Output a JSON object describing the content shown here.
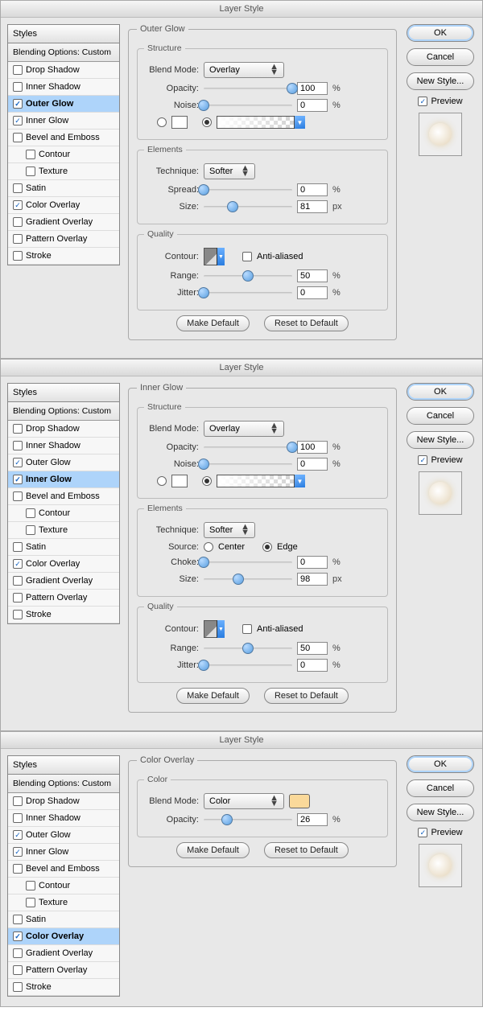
{
  "common": {
    "title": "Layer Style",
    "styles_head": "Styles",
    "blending": "Blending Options: Custom",
    "ok": "OK",
    "cancel": "Cancel",
    "new_style": "New Style...",
    "preview": "Preview",
    "make_default": "Make Default",
    "reset_default": "Reset to Default",
    "anti_aliased": "Anti-aliased",
    "units": {
      "pct": "%",
      "px": "px"
    }
  },
  "style_effects": [
    {
      "label": "Drop Shadow"
    },
    {
      "label": "Inner Shadow"
    },
    {
      "label": "Outer Glow"
    },
    {
      "label": "Inner Glow"
    },
    {
      "label": "Bevel and Emboss"
    },
    {
      "label": "Contour",
      "indent": true
    },
    {
      "label": "Texture",
      "indent": true
    },
    {
      "label": "Satin"
    },
    {
      "label": "Color Overlay"
    },
    {
      "label": "Gradient Overlay"
    },
    {
      "label": "Pattern Overlay"
    },
    {
      "label": "Stroke"
    }
  ],
  "panels": [
    {
      "selected": "Outer Glow",
      "checked": [
        "Outer Glow",
        "Inner Glow",
        "Color Overlay"
      ],
      "section_title": "Outer Glow",
      "structure": {
        "legend": "Structure",
        "blend_mode_label": "Blend Mode:",
        "blend_mode": "Overlay",
        "opacity_label": "Opacity:",
        "opacity": "100",
        "noise_label": "Noise:",
        "noise": "0",
        "fill_radio": "gradient"
      },
      "elements": {
        "legend": "Elements",
        "technique_label": "Technique:",
        "technique": "Softer",
        "spread_label": "Spread:",
        "spread": "0",
        "size_label": "Size:",
        "size": "81"
      },
      "quality": {
        "legend": "Quality",
        "contour_label": "Contour:",
        "range_label": "Range:",
        "range": "50",
        "jitter_label": "Jitter:",
        "jitter": "0"
      }
    },
    {
      "selected": "Inner Glow",
      "checked": [
        "Outer Glow",
        "Inner Glow",
        "Color Overlay"
      ],
      "section_title": "Inner Glow",
      "structure": {
        "legend": "Structure",
        "blend_mode_label": "Blend Mode:",
        "blend_mode": "Overlay",
        "opacity_label": "Opacity:",
        "opacity": "100",
        "noise_label": "Noise:",
        "noise": "0",
        "fill_radio": "gradient"
      },
      "elements": {
        "legend": "Elements",
        "technique_label": "Technique:",
        "technique": "Softer",
        "source_label": "Source:",
        "source_center": "Center",
        "source_edge": "Edge",
        "source_value": "Edge",
        "choke_label": "Choke:",
        "choke": "0",
        "size_label": "Size:",
        "size": "98"
      },
      "quality": {
        "legend": "Quality",
        "contour_label": "Contour:",
        "range_label": "Range:",
        "range": "50",
        "jitter_label": "Jitter:",
        "jitter": "0"
      }
    },
    {
      "selected": "Color Overlay",
      "checked": [
        "Outer Glow",
        "Inner Glow",
        "Color Overlay"
      ],
      "section_title": "Color Overlay",
      "color": {
        "legend": "Color",
        "blend_mode_label": "Blend Mode:",
        "blend_mode": "Color",
        "color_value": "#fad99a",
        "opacity_label": "Opacity:",
        "opacity": "26"
      }
    }
  ]
}
